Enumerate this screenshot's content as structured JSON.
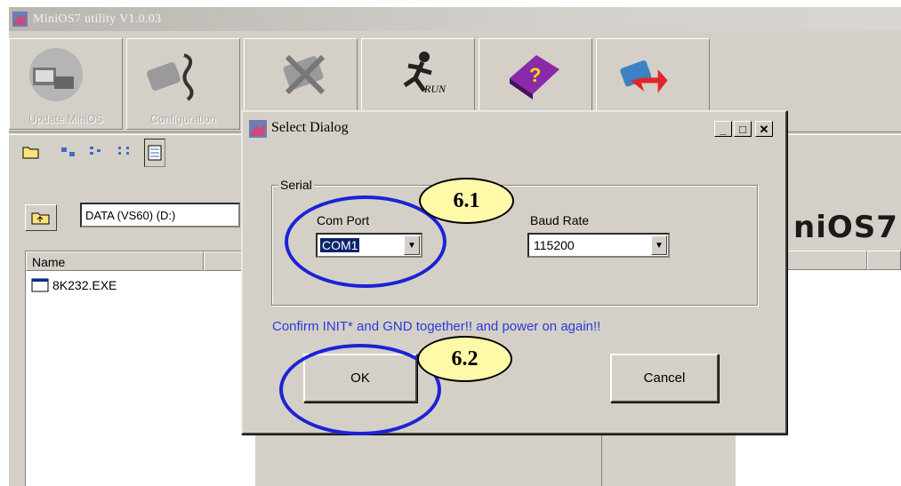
{
  "window": {
    "title": "MiniOS7 utility V1.0.03"
  },
  "toolbar": {
    "buttons": [
      {
        "label": "Update MiniOS",
        "icon": "update-minios-icon"
      },
      {
        "label": "Configuration",
        "icon": "configuration-icon"
      },
      {
        "label": "",
        "icon": "disconnect-icon"
      },
      {
        "label": "",
        "icon": "run-icon"
      },
      {
        "label": "",
        "icon": "help-book-icon"
      },
      {
        "label": "",
        "icon": "download-module-icon"
      }
    ]
  },
  "browser": {
    "path": "DATA (VS60) (D:)",
    "column_name": "Name",
    "files": [
      {
        "name": "8K232.EXE"
      }
    ],
    "brand_text": "niOS7"
  },
  "dialog": {
    "title": "Select Dialog",
    "group_label": "Serial",
    "com_port_label": "Com Port",
    "com_port_value": "COM1",
    "baud_rate_label": "Baud Rate",
    "baud_rate_value": "115200",
    "warning": "Confirm INIT* and GND together!! and power on again!!",
    "ok_label": "OK",
    "cancel_label": "Cancel",
    "minimize": "_",
    "maximize": "□",
    "close": "✕"
  },
  "annotations": {
    "step1": "6.1",
    "step2": "6.2",
    "ring_color": "#1c22d6",
    "badge_color": "#fff9a8"
  }
}
